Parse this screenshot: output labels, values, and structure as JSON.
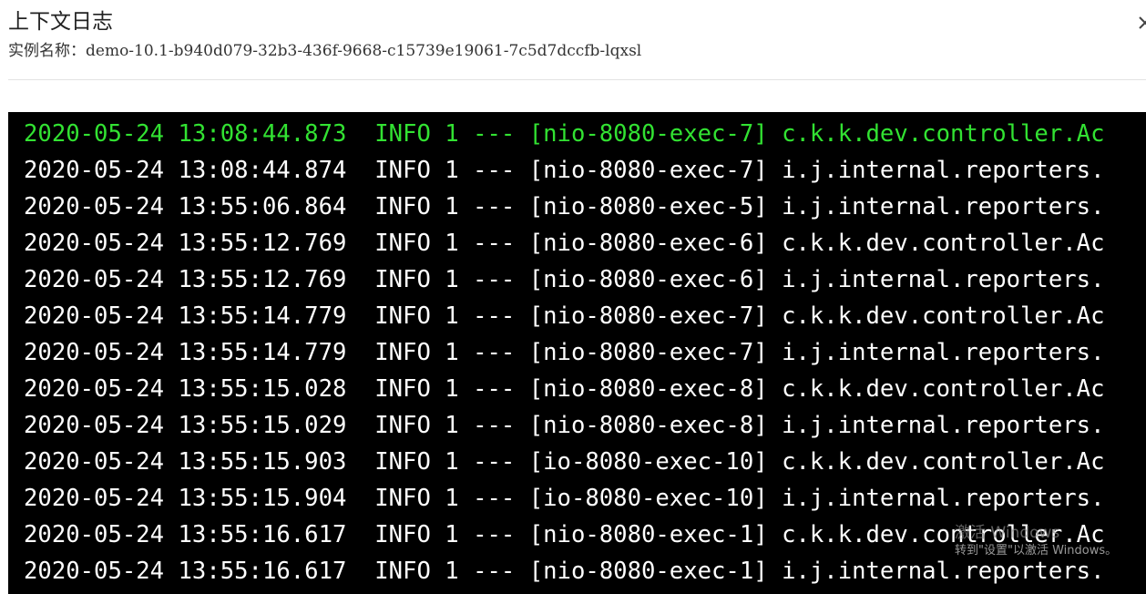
{
  "dialog": {
    "title": "上下文日志",
    "instance_label": "实例名称：",
    "instance_name": "demo-10.1-b940d079-32b3-436f-9668-c15739e19061-7c5d7dccfb-lqxsl",
    "close_icon": "close-icon"
  },
  "log": {
    "lines": [
      {
        "text": "2020-05-24 13:08:44.873  INFO 1 --- [nio-8080-exec-7] c.k.k.dev.controller.Ac",
        "highlight": true
      },
      {
        "text": "2020-05-24 13:08:44.874  INFO 1 --- [nio-8080-exec-7] i.j.internal.reporters.",
        "highlight": false
      },
      {
        "text": "2020-05-24 13:55:06.864  INFO 1 --- [nio-8080-exec-5] i.j.internal.reporters.",
        "highlight": false
      },
      {
        "text": "2020-05-24 13:55:12.769  INFO 1 --- [nio-8080-exec-6] c.k.k.dev.controller.Ac",
        "highlight": false
      },
      {
        "text": "2020-05-24 13:55:12.769  INFO 1 --- [nio-8080-exec-6] i.j.internal.reporters.",
        "highlight": false
      },
      {
        "text": "2020-05-24 13:55:14.779  INFO 1 --- [nio-8080-exec-7] c.k.k.dev.controller.Ac",
        "highlight": false
      },
      {
        "text": "2020-05-24 13:55:14.779  INFO 1 --- [nio-8080-exec-7] i.j.internal.reporters.",
        "highlight": false
      },
      {
        "text": "2020-05-24 13:55:15.028  INFO 1 --- [nio-8080-exec-8] c.k.k.dev.controller.Ac",
        "highlight": false
      },
      {
        "text": "2020-05-24 13:55:15.029  INFO 1 --- [nio-8080-exec-8] i.j.internal.reporters.",
        "highlight": false
      },
      {
        "text": "2020-05-24 13:55:15.903  INFO 1 --- [io-8080-exec-10] c.k.k.dev.controller.Ac",
        "highlight": false
      },
      {
        "text": "2020-05-24 13:55:15.904  INFO 1 --- [io-8080-exec-10] i.j.internal.reporters.",
        "highlight": false
      },
      {
        "text": "2020-05-24 13:55:16.617  INFO 1 --- [nio-8080-exec-1] c.k.k.dev.controller.Ac",
        "highlight": false
      },
      {
        "text": "2020-05-24 13:55:16.617  INFO 1 --- [nio-8080-exec-1] i.j.internal.reporters.",
        "highlight": false
      }
    ],
    "colors": {
      "background": "#000000",
      "text": "#ffffff",
      "highlight": "#32e232"
    }
  },
  "watermark": {
    "title": "激活 Windows",
    "subtitle": "转到\"设置\"以激活 Windows。"
  }
}
